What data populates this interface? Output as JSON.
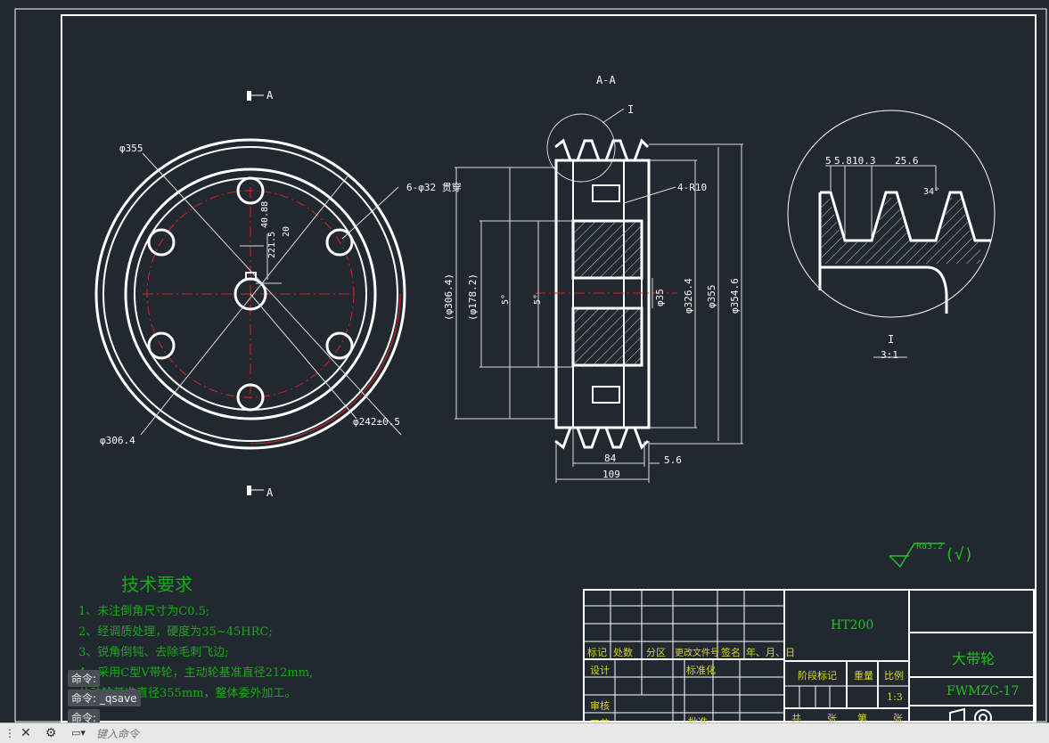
{
  "drawing": {
    "section_marks": [
      "A",
      "A"
    ],
    "section_view_title": "A-A",
    "detail_mark": "I",
    "detail_label": "I",
    "detail_scale": "3:1",
    "dims_front": {
      "d355": "φ355",
      "holes": "6-φ32 贯穿",
      "d306": "φ306.4",
      "d242": "φ242±0.5",
      "key1": "40.88",
      "key2": "20",
      "key3": "221.5"
    },
    "dims_section": {
      "r10": "4-R10",
      "d3064": "(φ306.4)",
      "d1782": "(φ178.2)",
      "ang1": "5°",
      "ang2": "5°",
      "d35": "φ35",
      "d3264": "φ326.4",
      "d355": "φ355",
      "d3546": "φ354.6",
      "w84": "84",
      "w56": "5.6",
      "w109": "109"
    },
    "dims_detail": {
      "a": "5",
      "b": "5.8",
      "c": "10.3",
      "d": "25.6",
      "angle": "34°"
    },
    "roughness": "Ra3.2",
    "roughness_other": "(√)"
  },
  "tech": {
    "title": "技术要求",
    "lines": [
      "1、未注倒角尺寸为C0.5;",
      "2、经调质处理，硬度为35~45HRC;",
      "3、锐角倒钝、去除毛刺飞边;",
      "4、采用C型V带轮，主动轮基准直径212mm,",
      "   从动轮基准直径355mm，整体委外加工。"
    ]
  },
  "title_block": {
    "material": "HT200",
    "part_name": "大带轮",
    "drawing_no": "FWMZC-17",
    "header_cells": [
      "标记",
      "处数",
      "分区",
      "更改文件号",
      "签名",
      "年、月、日"
    ],
    "design": "设计",
    "standard": "标准化",
    "stage": "阶段标记",
    "weight": "重量",
    "ratio_label": "比例",
    "ratio": "1:3",
    "review": "审核",
    "process": "工艺",
    "approve": "批准",
    "sheets": [
      "共",
      "张",
      "第",
      "张"
    ]
  },
  "command": {
    "history": [
      "命令:",
      "命令: _qsave",
      "命令:"
    ],
    "placeholder": "键入命令"
  }
}
